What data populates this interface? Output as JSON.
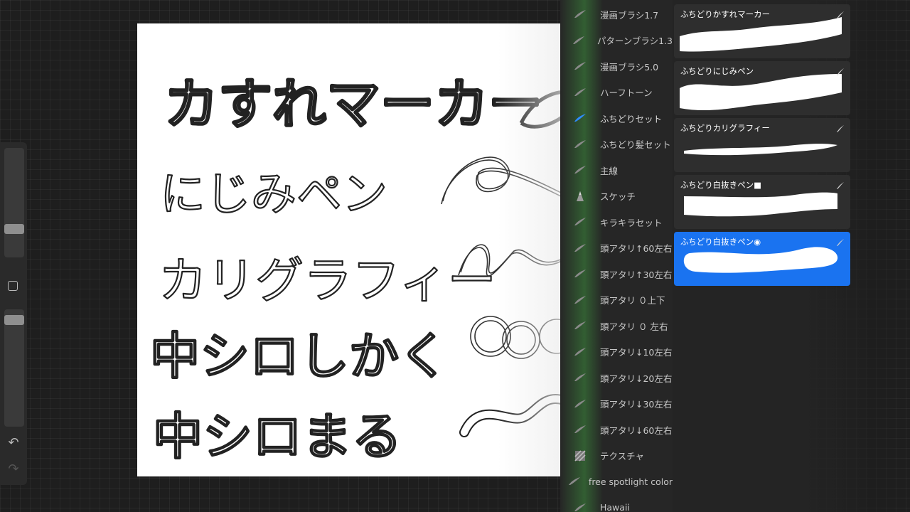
{
  "brush_sets": [
    {
      "label": "漫画ブラシ1.7",
      "icon": "brush-set-icon",
      "active": false
    },
    {
      "label": "パターンブラシ1.3",
      "icon": "brush-set-icon",
      "active": false
    },
    {
      "label": "漫画ブラシ5.0",
      "icon": "brush-set-icon",
      "active": false
    },
    {
      "label": "ハーフトーン",
      "icon": "brush-set-icon",
      "active": false
    },
    {
      "label": "ふちどりセット",
      "icon": "brush-set-icon",
      "active": true
    },
    {
      "label": "ふちどり髪セット",
      "icon": "brush-set-icon",
      "active": false
    },
    {
      "label": "主線",
      "icon": "brush-set-icon",
      "active": false
    },
    {
      "label": "スケッチ",
      "icon": "pencil-tip-icon",
      "active": false
    },
    {
      "label": "キラキラセット",
      "icon": "brush-set-icon",
      "active": false
    },
    {
      "label": "頭アタリ↑60左右",
      "icon": "brush-set-icon",
      "active": false
    },
    {
      "label": "頭アタリ↑30左右",
      "icon": "brush-set-icon",
      "active": false
    },
    {
      "label": "頭アタリ ０上下",
      "icon": "brush-set-icon",
      "active": false
    },
    {
      "label": "頭アタリ ０ 左右",
      "icon": "brush-set-icon",
      "active": false
    },
    {
      "label": "頭アタリ↓10左右",
      "icon": "brush-set-icon",
      "active": false
    },
    {
      "label": "頭アタリ↓20左右",
      "icon": "brush-set-icon",
      "active": false
    },
    {
      "label": "頭アタリ↓30左右",
      "icon": "brush-set-icon",
      "active": false
    },
    {
      "label": "頭アタリ↓60左右",
      "icon": "brush-set-icon",
      "active": false
    },
    {
      "label": "テクスチャ",
      "icon": "texture-icon",
      "active": false
    },
    {
      "label": "free spotlight color",
      "icon": "brush-set-icon",
      "active": false
    },
    {
      "label": "Hawaii",
      "icon": "brush-set-icon",
      "active": false
    }
  ],
  "brushes": [
    {
      "name": "ふちどりかすれマーカー",
      "stroke": "rough-thick",
      "selected": false
    },
    {
      "name": "ふちどりにじみペン",
      "stroke": "rough-thick-wave",
      "selected": false
    },
    {
      "name": "ふちどりカリグラフィー",
      "stroke": "thin-taper",
      "selected": false
    },
    {
      "name": "ふちどり白抜きペン■",
      "stroke": "flat-square",
      "selected": false
    },
    {
      "name": "ふちどり白抜きペン◉",
      "stroke": "round-wave",
      "selected": true
    }
  ],
  "canvas": {
    "lines": [
      "カすれマーカー",
      "にじみペン",
      "カリグラフィー",
      "中シロしかく",
      "中シロまる"
    ]
  },
  "colors": {
    "accent": "#1a73f0",
    "panel": "#242424",
    "card": "#2e2e2e"
  }
}
